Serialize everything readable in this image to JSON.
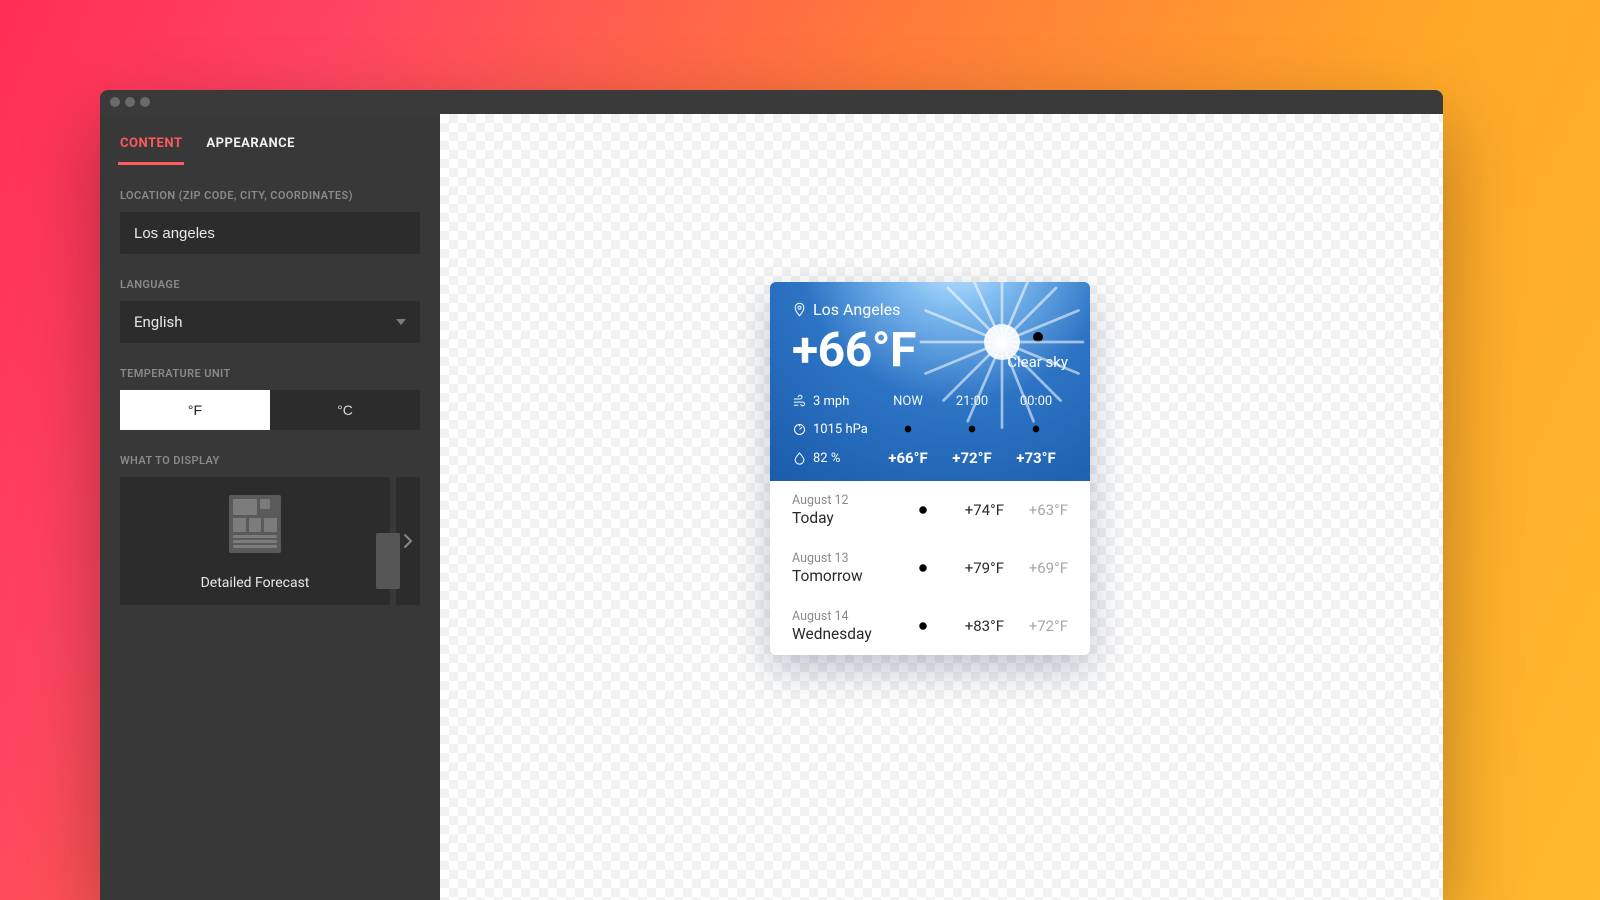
{
  "tabs": {
    "content": "CONTENT",
    "appearance": "APPEARANCE"
  },
  "labels": {
    "location": "LOCATION (ZIP CODE, CITY, COORDINATES)",
    "language": "LANGUAGE",
    "unit": "TEMPERATURE UNIT",
    "display": "WHAT TO DISPLAY"
  },
  "location_value": "Los angeles",
  "language_value": "English",
  "units": {
    "f": "°F",
    "c": "°C"
  },
  "display_option": "Detailed Forecast",
  "weather": {
    "location": "Los Angeles",
    "temp": "+66°F",
    "condition": "Clear sky",
    "wind": "3 mph",
    "pressure": "1015 hPa",
    "humidity": "82 %",
    "hours": [
      {
        "label": "NOW",
        "temp": "+66°F"
      },
      {
        "label": "21:00",
        "temp": "+72°F"
      },
      {
        "label": "00:00",
        "temp": "+73°F"
      }
    ],
    "forecast": [
      {
        "date": "August 12",
        "day": "Today",
        "hi": "+74°F",
        "lo": "+63°F"
      },
      {
        "date": "August 13",
        "day": "Tomorrow",
        "hi": "+79°F",
        "lo": "+69°F"
      },
      {
        "date": "August 14",
        "day": "Wednesday",
        "hi": "+83°F",
        "lo": "+72°F"
      }
    ]
  }
}
